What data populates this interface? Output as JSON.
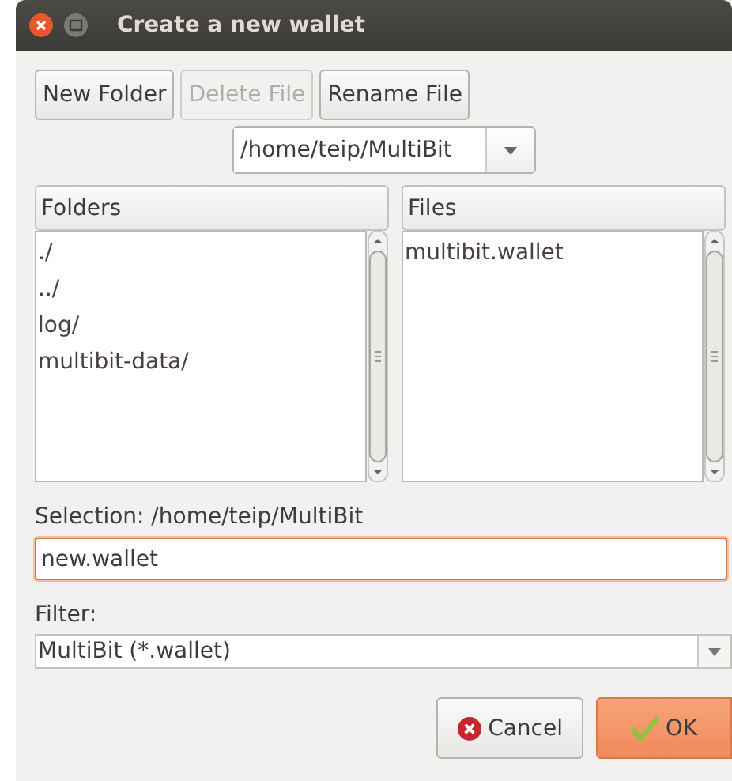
{
  "window": {
    "title": "Create a new wallet"
  },
  "toolbar": [
    {
      "label": "New Folder",
      "disabled": false
    },
    {
      "label": "Delete File",
      "disabled": true
    },
    {
      "label": "Rename File",
      "disabled": false
    }
  ],
  "path_combo": {
    "value": "/home/teip/MultiBit"
  },
  "folders": {
    "header": "Folders",
    "items": [
      "./",
      "../",
      "log/",
      "multibit-data/"
    ]
  },
  "files": {
    "header": "Files",
    "items": [
      "multibit.wallet"
    ]
  },
  "selection": {
    "label": "Selection: /home/teip/MultiBit",
    "value": "new.wallet"
  },
  "filter": {
    "label": "Filter:",
    "value": "MultiBit (*.wallet)"
  },
  "buttons": [
    {
      "label": "Cancel",
      "kind": "cancel"
    },
    {
      "label": "OK",
      "kind": "ok"
    }
  ]
}
